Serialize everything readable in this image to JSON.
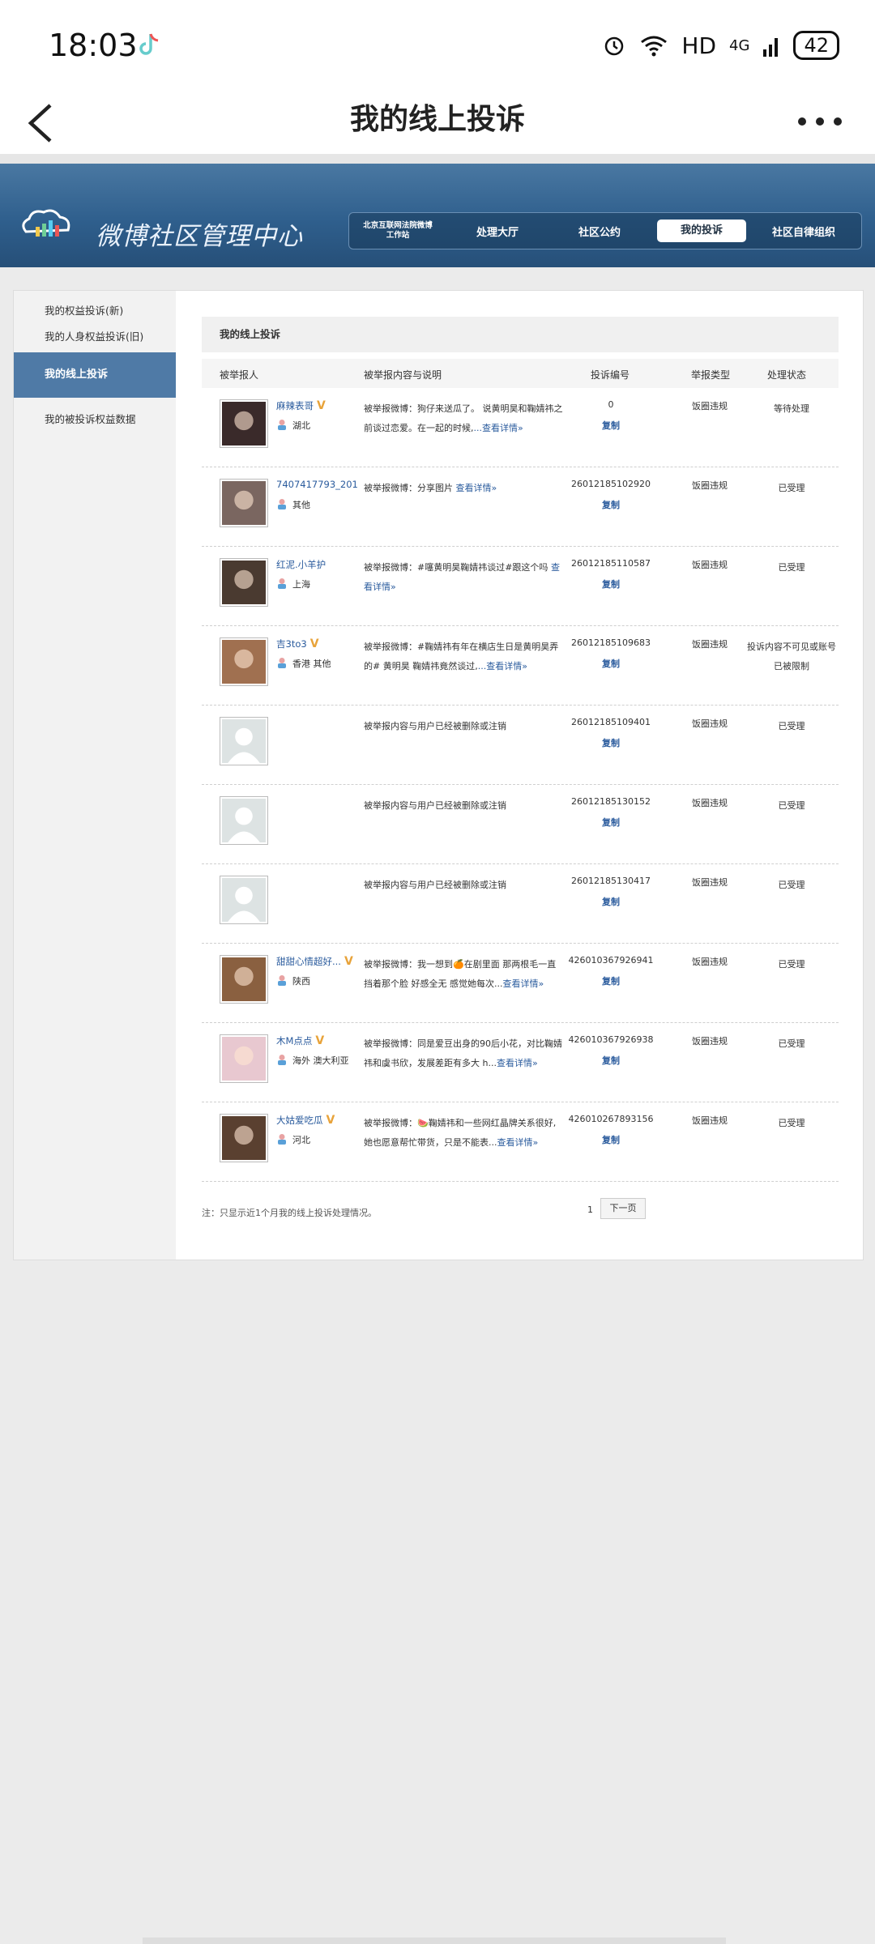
{
  "status": {
    "time": "18:03",
    "net": "HD",
    "net2": "4G",
    "battery": "42"
  },
  "appbar": {
    "title": "我的线上投诉"
  },
  "banner": {
    "site": "微博社区管理中心"
  },
  "nav": [
    {
      "label": "北京互联网法院微博\n工作站",
      "cls": "small"
    },
    {
      "label": "处理大厅",
      "cls": "n"
    },
    {
      "label": "社区公约",
      "cls": "n"
    },
    {
      "label": "我的投诉",
      "cls": "active"
    },
    {
      "label": "社区自律组织",
      "cls": "n"
    }
  ],
  "sidebar": {
    "items": [
      "我的权益投诉(新)",
      "我的人身权益投诉(旧)",
      "我的线上投诉",
      "我的被投诉权益数据"
    ]
  },
  "content": {
    "title": "我的线上投诉",
    "headers": [
      "被举报人",
      "被举报内容与说明",
      "投诉编号",
      "举报类型",
      "处理状态"
    ],
    "rows": [
      {
        "name": "麻辣表哥",
        "v": true,
        "loc": "湖北",
        "desc": "被举报微博：狗仔来送瓜了。 说黄明昊和鞠婧祎之前谈过恋爱。在一起的时候,",
        "link": "...查看详情»",
        "id": "0",
        "copy": "复制",
        "type": "饭圈违规",
        "state": "等待处理",
        "avatar": "#3a2a2a"
      },
      {
        "name": "7407417793_201",
        "v": false,
        "loc": "其他",
        "desc": "被举报微博：分享图片 ",
        "link": "查看详情»",
        "id": "26012185102920",
        "copy": "复制",
        "type": "饭圈违规",
        "state": "已受理",
        "avatar": "#7a6660"
      },
      {
        "name": "红泥.小羊护",
        "v": false,
        "loc": "上海",
        "desc": "被举报微博：#噻黄明昊鞠婧祎谈过#跟这个吗 ",
        "link": "查看详情»",
        "id": "26012185110587",
        "copy": "复制",
        "type": "饭圈违规",
        "state": "已受理",
        "avatar": "#4a3a30"
      },
      {
        "name": "吉3to3",
        "v": true,
        "loc": "香港  其他",
        "desc": "被举报微博：#鞠婧祎有年在横店生日是黄明昊弄的# 黄明昊 鞠婧祎竟然谈过,",
        "link": "...查看详情»",
        "id": "26012185109683",
        "copy": "复制",
        "type": "饭圈违规",
        "state": "投诉内容不可见或账号已被限制",
        "avatar": "#a07050"
      },
      {
        "name": "",
        "v": false,
        "loc": "",
        "desc": "被举报内容与用户已经被删除或注销",
        "link": "",
        "id": "26012185109401",
        "copy": "复制",
        "type": "饭圈违规",
        "state": "已受理",
        "avatar": "#dde3e3"
      },
      {
        "name": "",
        "v": false,
        "loc": "",
        "desc": "被举报内容与用户已经被删除或注销",
        "link": "",
        "id": "26012185130152",
        "copy": "复制",
        "type": "饭圈违规",
        "state": "已受理",
        "avatar": "#dde3e3"
      },
      {
        "name": "",
        "v": false,
        "loc": "",
        "desc": "被举报内容与用户已经被删除或注销",
        "link": "",
        "id": "26012185130417",
        "copy": "复制",
        "type": "饭圈违规",
        "state": "已受理",
        "avatar": "#dde3e3"
      },
      {
        "name": "甜甜心情超好...",
        "v": true,
        "loc": "陕西",
        "desc": "被举报微博：我一想到🍊在剧里面 那两根毛一直挡着那个脸 好感全无 感觉她每次...",
        "link": "查看详情»",
        "id": "426010367926941",
        "copy": "复制",
        "type": "饭圈违规",
        "state": "已受理",
        "avatar": "#8a6040"
      },
      {
        "name": "木M点点",
        "v": true,
        "loc": "海外  澳大利亚",
        "desc": "被举报微博：同是爱豆出身的90后小花，对比鞠婧祎和虞书欣，发展差距有多大 h...",
        "link": "查看详情»",
        "id": "426010367926938",
        "copy": "复制",
        "type": "饭圈违规",
        "state": "已受理",
        "avatar": "#e8c8d0"
      },
      {
        "name": "大姑爱吃瓜",
        "v": true,
        "loc": "河北",
        "desc": "被举报微博：🍉鞠婧祎和一些网红晶牌关系很好,她也愿意帮忙带货，只是不能表...",
        "link": "查看详情»",
        "id": "426010267893156",
        "copy": "复制",
        "type": "饭圈违规",
        "state": "已受理",
        "avatar": "#5a4030"
      }
    ],
    "footnote": "注：只显示近1个月我的线上投诉处理情况。",
    "pager": {
      "page": "1",
      "next": "下一页"
    }
  }
}
